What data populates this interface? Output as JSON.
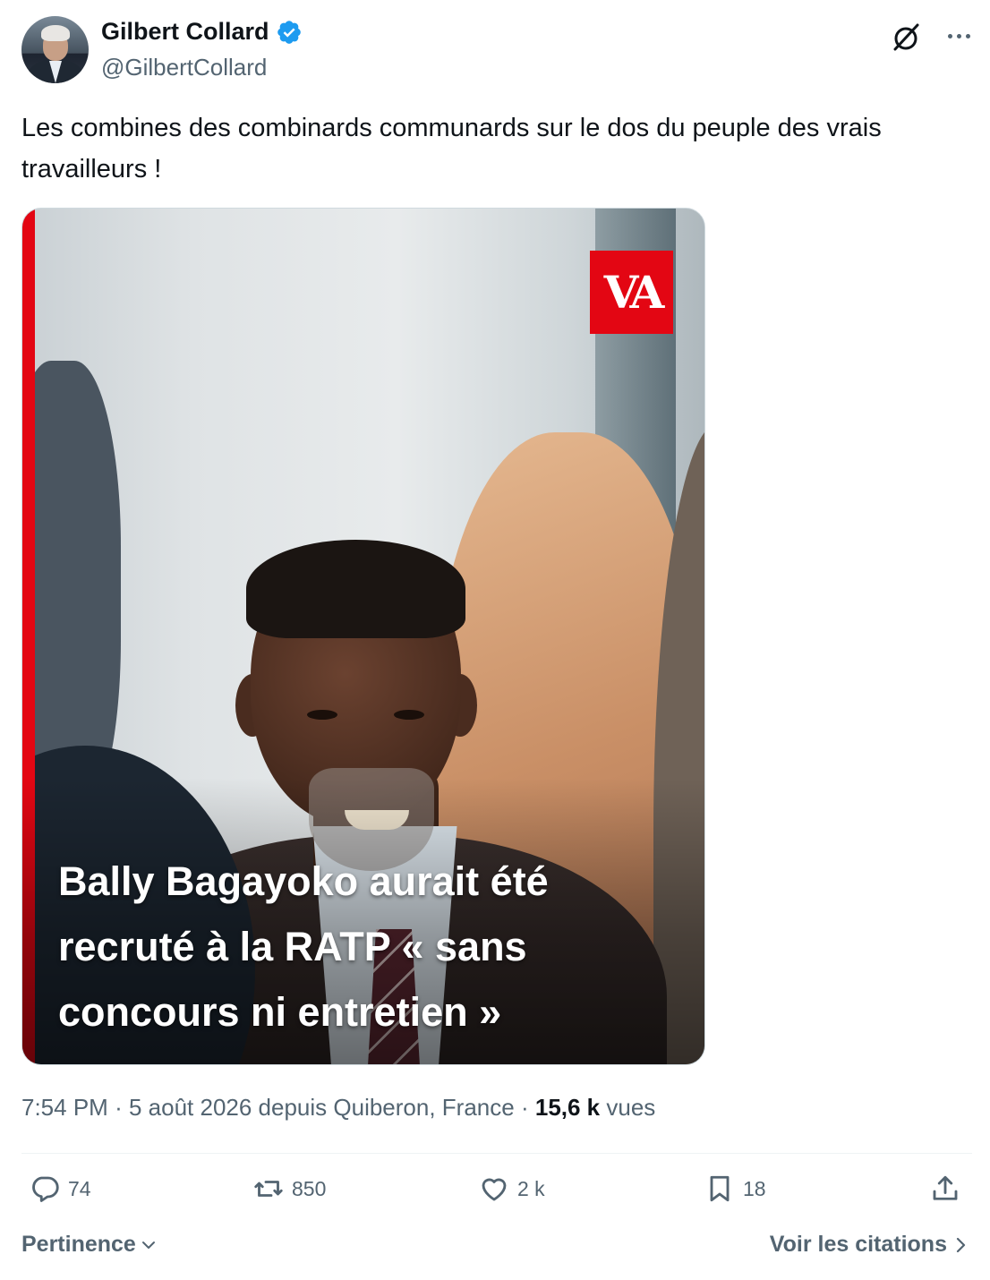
{
  "author": {
    "name": "Gilbert Collard",
    "handle": "@GilbertCollard",
    "verified_color": "#1d9bf0"
  },
  "tweet": {
    "text": "Les combines des combinards communards sur le dos du peuple des vrais travailleurs !"
  },
  "media": {
    "logo_text": "VA",
    "caption": "Bally Bagayoko aurait été recruté à la RATP « sans concours ni entretien »",
    "accent_color": "#e30613"
  },
  "meta": {
    "time": "7:54 PM",
    "separator": "·",
    "date_location": "5 août 2026 depuis Quiberon, France",
    "views_count": "15,6 k",
    "views_label": "vues"
  },
  "actions": {
    "replies": "74",
    "retweets": "850",
    "likes": "2 k",
    "bookmarks": "18"
  },
  "footer": {
    "sort_label": "Pertinence",
    "quotes_label": "Voir les citations"
  },
  "icons": [
    "grok-icon",
    "more-icon",
    "verified-badge-icon",
    "reply-icon",
    "retweet-icon",
    "like-icon",
    "bookmark-icon",
    "share-icon",
    "chevron-down-icon",
    "chevron-right-icon"
  ]
}
